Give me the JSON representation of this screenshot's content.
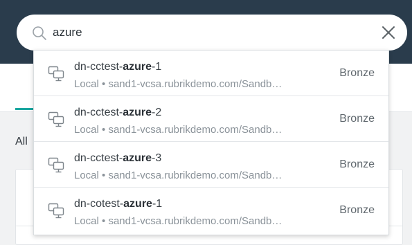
{
  "search": {
    "query": "azure",
    "placeholder": ""
  },
  "background": {
    "filter_label": "All"
  },
  "results": [
    {
      "name_prefix": "dn-cctest-",
      "name_match": "azure",
      "name_suffix": "-1",
      "path": "Local • sand1-vcsa.rubrikdemo.com/Sandb…",
      "sla": "Bronze",
      "icon": "virtual-machine-icon"
    },
    {
      "name_prefix": "dn-cctest-",
      "name_match": "azure",
      "name_suffix": "-2",
      "path": "Local • sand1-vcsa.rubrikdemo.com/Sandb…",
      "sla": "Bronze",
      "icon": "virtual-machine-icon"
    },
    {
      "name_prefix": "dn-cctest-",
      "name_match": "azure",
      "name_suffix": "-3",
      "path": "Local • sand1-vcsa.rubrikdemo.com/Sandb…",
      "sla": "Bronze",
      "icon": "virtual-machine-icon"
    },
    {
      "name_prefix": "dn-cotest-",
      "name_match": "azure",
      "name_suffix": "-1",
      "path": "Local • sand1-vcsa.rubrikdemo.com/Sandb…",
      "sla": "Bronze",
      "icon": "virtual-machine-icon"
    }
  ],
  "colors": {
    "header": "#2a3c4c",
    "accent": "#1aa6a0"
  },
  "icons": {
    "search": "search-icon",
    "clear": "close-icon"
  }
}
